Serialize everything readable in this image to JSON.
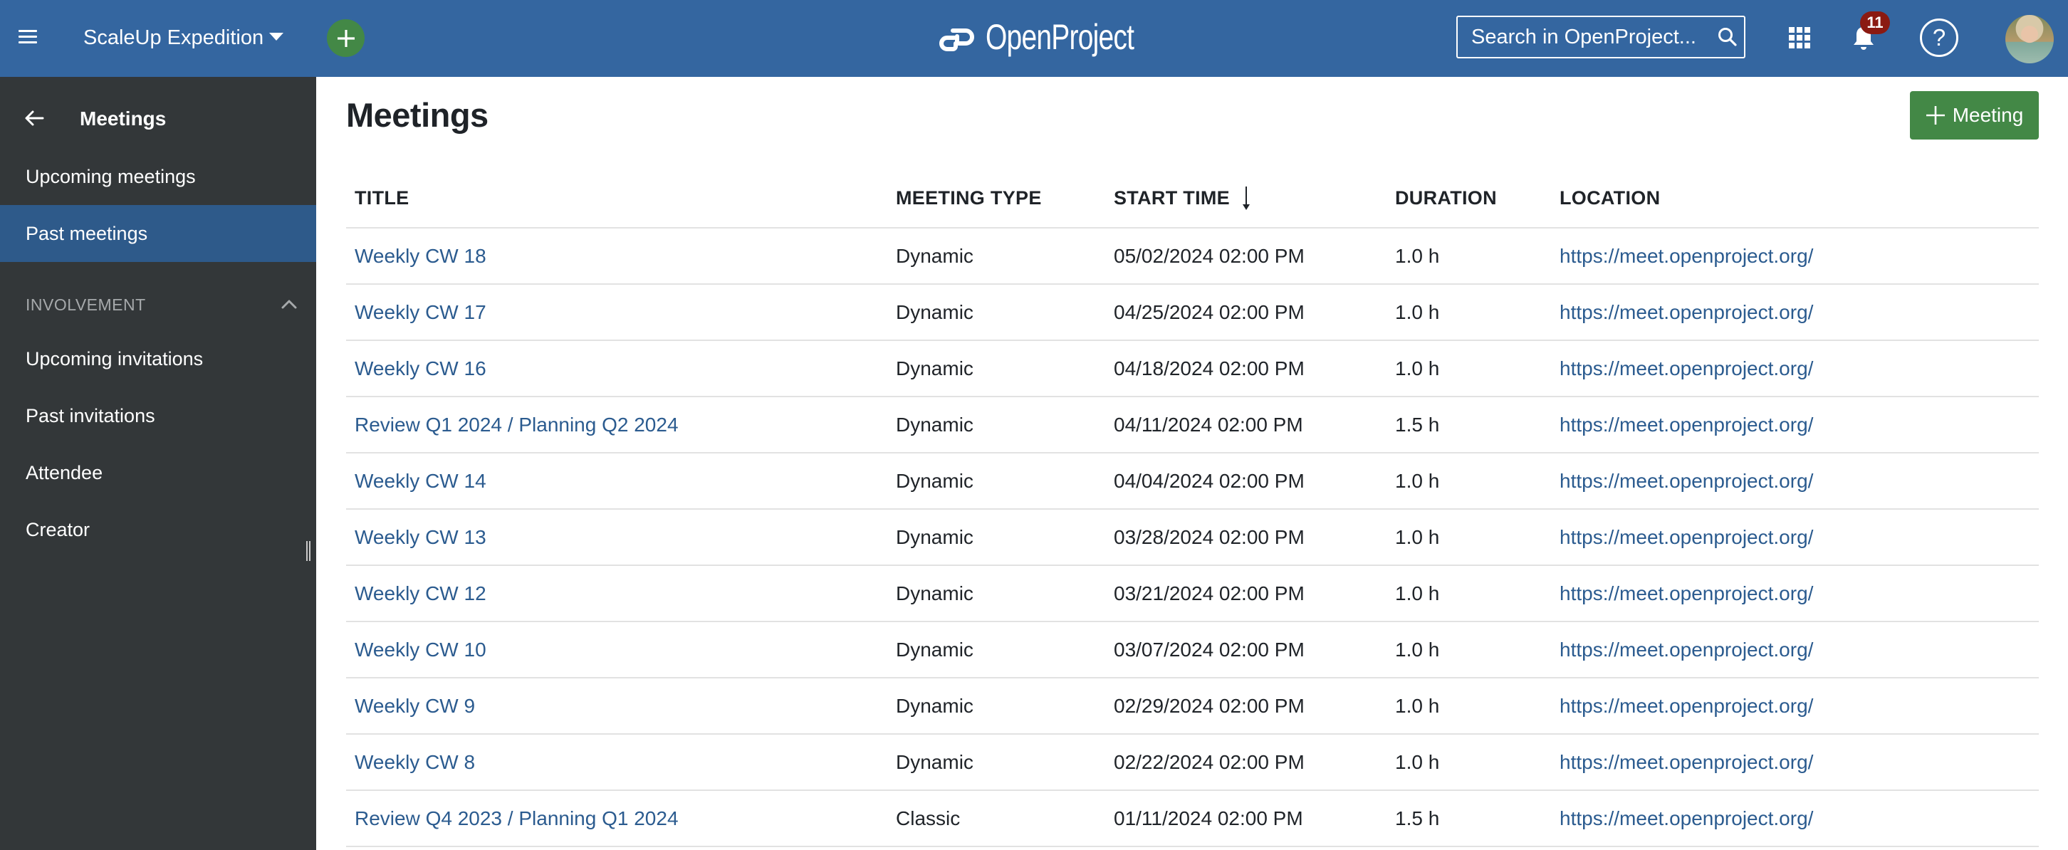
{
  "header": {
    "project_name": "ScaleUp Expedition",
    "logo_text": "OpenProject",
    "search_placeholder": "Search in OpenProject...",
    "notification_count": "11",
    "help_label": "?",
    "colors": {
      "header_bg": "#3466a0",
      "create_button": "#438846",
      "badge": "#8b1a12"
    }
  },
  "sidebar": {
    "title": "Meetings",
    "items": [
      {
        "label": "Upcoming meetings",
        "active": false
      },
      {
        "label": "Past meetings",
        "active": true
      }
    ],
    "section": {
      "label": "INVOLVEMENT",
      "items": [
        {
          "label": "Upcoming invitations"
        },
        {
          "label": "Past invitations"
        },
        {
          "label": "Attendee"
        },
        {
          "label": "Creator"
        }
      ]
    },
    "colors": {
      "bg": "#333739",
      "active_bg": "#2e5a8a"
    }
  },
  "main": {
    "title": "Meetings",
    "add_button_label": "Meeting",
    "table": {
      "columns": [
        "TITLE",
        "MEETING TYPE",
        "START TIME",
        "DURATION",
        "LOCATION"
      ],
      "sorted_column": "START TIME",
      "sort_direction": "descending",
      "rows": [
        {
          "title": "Weekly CW 18",
          "type": "Dynamic",
          "start": "05/02/2024 02:00 PM",
          "duration": "1.0 h",
          "location": "https://meet.openproject.org/"
        },
        {
          "title": "Weekly CW 17",
          "type": "Dynamic",
          "start": "04/25/2024 02:00 PM",
          "duration": "1.0 h",
          "location": "https://meet.openproject.org/"
        },
        {
          "title": "Weekly CW 16",
          "type": "Dynamic",
          "start": "04/18/2024 02:00 PM",
          "duration": "1.0 h",
          "location": "https://meet.openproject.org/"
        },
        {
          "title": "Review Q1 2024 / Planning Q2 2024",
          "type": "Dynamic",
          "start": "04/11/2024 02:00 PM",
          "duration": "1.5 h",
          "location": "https://meet.openproject.org/"
        },
        {
          "title": "Weekly CW 14",
          "type": "Dynamic",
          "start": "04/04/2024 02:00 PM",
          "duration": "1.0 h",
          "location": "https://meet.openproject.org/"
        },
        {
          "title": "Weekly CW 13",
          "type": "Dynamic",
          "start": "03/28/2024 02:00 PM",
          "duration": "1.0 h",
          "location": "https://meet.openproject.org/"
        },
        {
          "title": "Weekly CW 12",
          "type": "Dynamic",
          "start": "03/21/2024 02:00 PM",
          "duration": "1.0 h",
          "location": "https://meet.openproject.org/"
        },
        {
          "title": "Weekly CW 10",
          "type": "Dynamic",
          "start": "03/07/2024 02:00 PM",
          "duration": "1.0 h",
          "location": "https://meet.openproject.org/"
        },
        {
          "title": "Weekly CW 9",
          "type": "Dynamic",
          "start": "02/29/2024 02:00 PM",
          "duration": "1.0 h",
          "location": "https://meet.openproject.org/"
        },
        {
          "title": "Weekly CW 8",
          "type": "Dynamic",
          "start": "02/22/2024 02:00 PM",
          "duration": "1.0 h",
          "location": "https://meet.openproject.org/"
        },
        {
          "title": "Review Q4 2023 / Planning Q1 2024",
          "type": "Classic",
          "start": "01/11/2024 02:00 PM",
          "duration": "1.5 h",
          "location": "https://meet.openproject.org/"
        }
      ]
    },
    "colors": {
      "link": "#2b5b8f",
      "add_button": "#438846"
    }
  }
}
